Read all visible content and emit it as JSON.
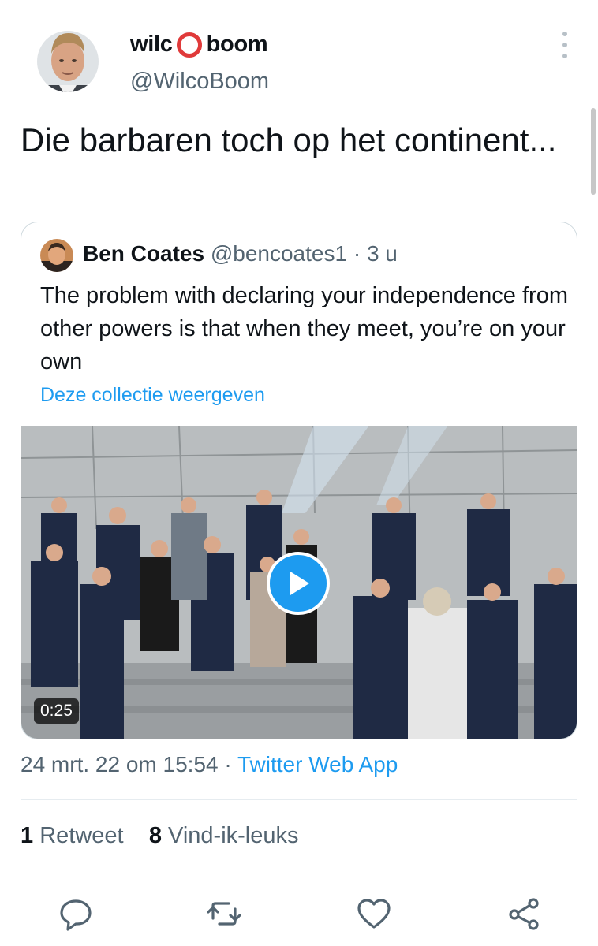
{
  "author": {
    "name_left": "wilc",
    "name_right": "boom",
    "handle": "@WilcoBoom"
  },
  "tweet": {
    "text": "Die barbaren toch op het continent..."
  },
  "quote": {
    "name": "Ben Coates",
    "handle": "@bencoates1",
    "separator": "·",
    "time": "3 u",
    "text": "The problem with declaring your independence from other powers is that when they meet, you’re on your own",
    "collection_link": "Deze collectie weergeven",
    "video": {
      "duration": "0:25"
    }
  },
  "meta": {
    "date": "24 mrt. 22 om 15:54",
    "separator": "·",
    "app": "Twitter Web App"
  },
  "stats": {
    "retweets_count": "1",
    "retweets_label": "Retweet",
    "likes_count": "8",
    "likes_label": "Vind-ik-leuks"
  },
  "icons": {
    "reply": "reply-icon",
    "retweet": "retweet-icon",
    "like": "heart-icon",
    "share": "share-icon",
    "more": "more-options-icon",
    "play": "play-icon"
  },
  "colors": {
    "accent": "#1d9bf0",
    "text": "#0f1419",
    "secondary": "#536471",
    "logo_ring": "#e03a3a"
  }
}
